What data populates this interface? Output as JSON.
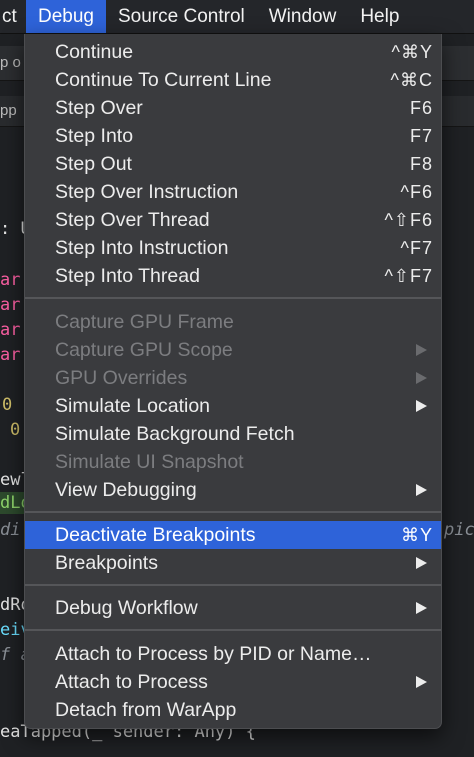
{
  "menubar": {
    "items": [
      "ct",
      "Debug",
      "Source Control",
      "Window",
      "Help"
    ]
  },
  "editor_fragments": {
    "toolbar_text": "p o",
    "tab_text": "pp",
    "frag1": ": U",
    "frag_var": "ar",
    "frag_0a": "0",
    "frag_0b": "0",
    "frag_ew": "ewl",
    "frag_dl": "dLo",
    "frag_di": "di",
    "frag_pic": "pic",
    "frag_dr": "dRo",
    "frag_ei": "eiv",
    "frag_fa": "f a",
    "frag_bottom": "eaTapped(_ sender: Any) {"
  },
  "menu": {
    "items": [
      {
        "label": "Continue",
        "shortcut": "^⌘Y"
      },
      {
        "label": "Continue To Current Line",
        "shortcut": "^⌘C"
      },
      {
        "label": "Step Over",
        "shortcut": "F6"
      },
      {
        "label": "Step Into",
        "shortcut": "F7"
      },
      {
        "label": "Step Out",
        "shortcut": "F8"
      },
      {
        "label": "Step Over Instruction",
        "shortcut": "^F6"
      },
      {
        "label": "Step Over Thread",
        "shortcut": "^⇧F6"
      },
      {
        "label": "Step Into Instruction",
        "shortcut": "^F7"
      },
      {
        "label": "Step Into Thread",
        "shortcut": "^⇧F7"
      },
      {
        "label": "Capture GPU Frame",
        "shortcut": ""
      },
      {
        "label": "Capture GPU Scope",
        "shortcut": ""
      },
      {
        "label": "GPU Overrides",
        "shortcut": ""
      },
      {
        "label": "Simulate Location",
        "shortcut": ""
      },
      {
        "label": "Simulate Background Fetch",
        "shortcut": ""
      },
      {
        "label": "Simulate UI Snapshot",
        "shortcut": ""
      },
      {
        "label": "View Debugging",
        "shortcut": ""
      },
      {
        "label": "Deactivate Breakpoints",
        "shortcut": "⌘Y"
      },
      {
        "label": "Breakpoints",
        "shortcut": ""
      },
      {
        "label": "Debug Workflow",
        "shortcut": ""
      },
      {
        "label": "Attach to Process by PID or Name…",
        "shortcut": ""
      },
      {
        "label": "Attach to Process",
        "shortcut": ""
      },
      {
        "label": "Detach from WarApp",
        "shortcut": ""
      }
    ]
  },
  "colors": {
    "menubar_bg": "#24262a",
    "menu_bg": "#3a3b3e",
    "selection": "#2e63d9",
    "disabled_text": "#7c7d80"
  }
}
